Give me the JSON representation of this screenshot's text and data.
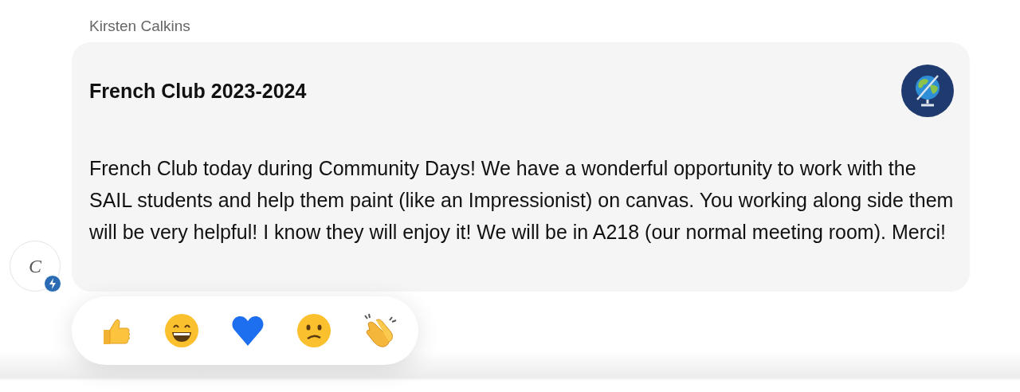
{
  "message": {
    "author": "Kirsten Calkins",
    "title": "French Club 2023-2024",
    "body": "French Club today during Community Days!  We have a wonderful opportunity to work with the SAIL students and help them paint (like an Impressionist) on canvas.  You working along side them will be very helpful! I know they will enjoy it! We will be in A218 (our normal meeting room).  Merci!",
    "avatar_initial": "C"
  },
  "reactions": [
    {
      "kind": "thumbs_up"
    },
    {
      "kind": "grin"
    },
    {
      "kind": "heart"
    },
    {
      "kind": "confused"
    },
    {
      "kind": "clap"
    }
  ]
}
